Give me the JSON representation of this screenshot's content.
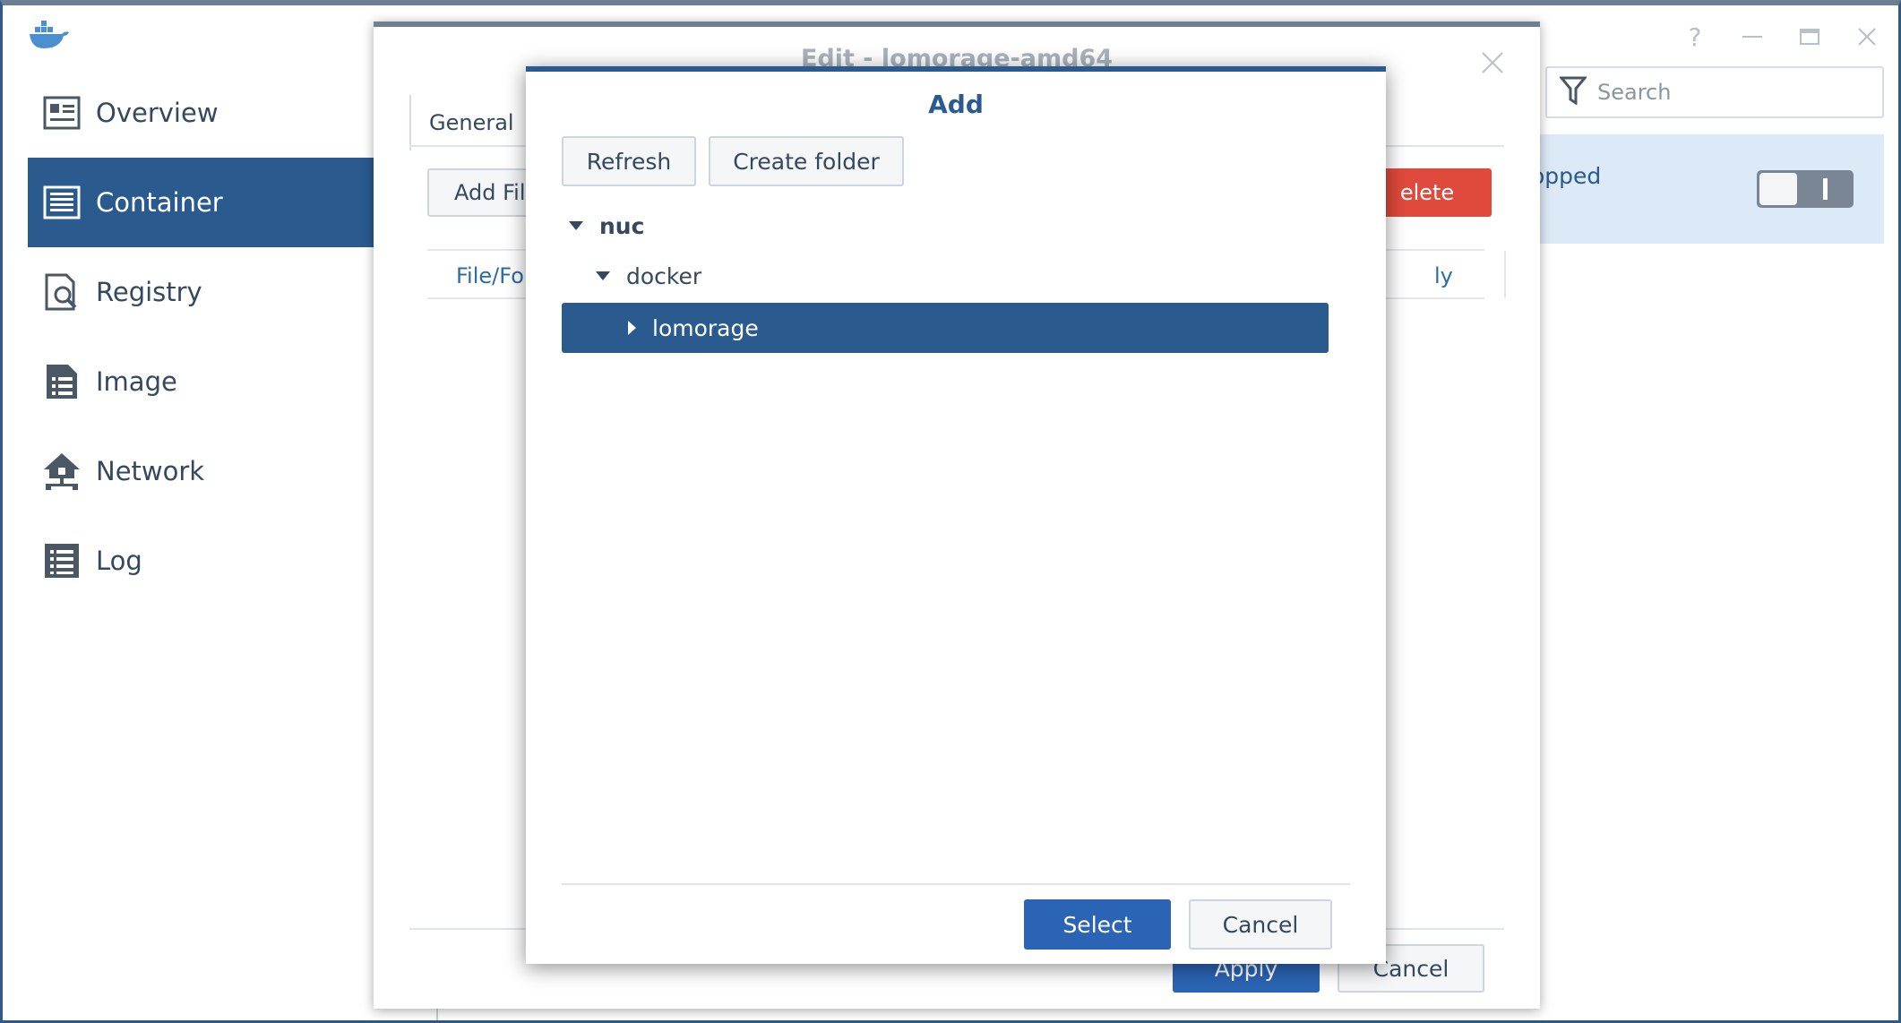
{
  "app": {
    "logo_icon": "docker-whale-icon",
    "window_controls": [
      "help-icon",
      "minimize-icon",
      "maximize-icon",
      "close-icon"
    ]
  },
  "sidebar": {
    "items": [
      {
        "label": "Overview",
        "icon": "overview-icon"
      },
      {
        "label": "Container",
        "icon": "container-icon",
        "active": true
      },
      {
        "label": "Registry",
        "icon": "registry-icon"
      },
      {
        "label": "Image",
        "icon": "image-icon"
      },
      {
        "label": "Network",
        "icon": "network-icon"
      },
      {
        "label": "Log",
        "icon": "log-icon"
      }
    ]
  },
  "main": {
    "search_placeholder": "Search",
    "status_partial": "opped"
  },
  "edit_dialog": {
    "title": "Edit - lomorage-amd64",
    "tab_general": "General",
    "add_file_btn": "Add Fil",
    "delete_btn": "elete",
    "col_file_folder": "File/Fold",
    "col_readonly": "ly",
    "apply_btn": "Apply",
    "cancel_btn": "Cancel"
  },
  "add_dialog": {
    "title": "Add",
    "refresh_btn": "Refresh",
    "create_folder_btn": "Create folder",
    "tree": {
      "root": "nuc",
      "child": "docker",
      "selected": "lomorage"
    },
    "select_btn": "Select",
    "cancel_btn": "Cancel"
  },
  "colors": {
    "accent": "#2a5a8e",
    "primary_button": "#2b64b4",
    "danger": "#e04a3c",
    "selection_band": "#dce9f7"
  }
}
